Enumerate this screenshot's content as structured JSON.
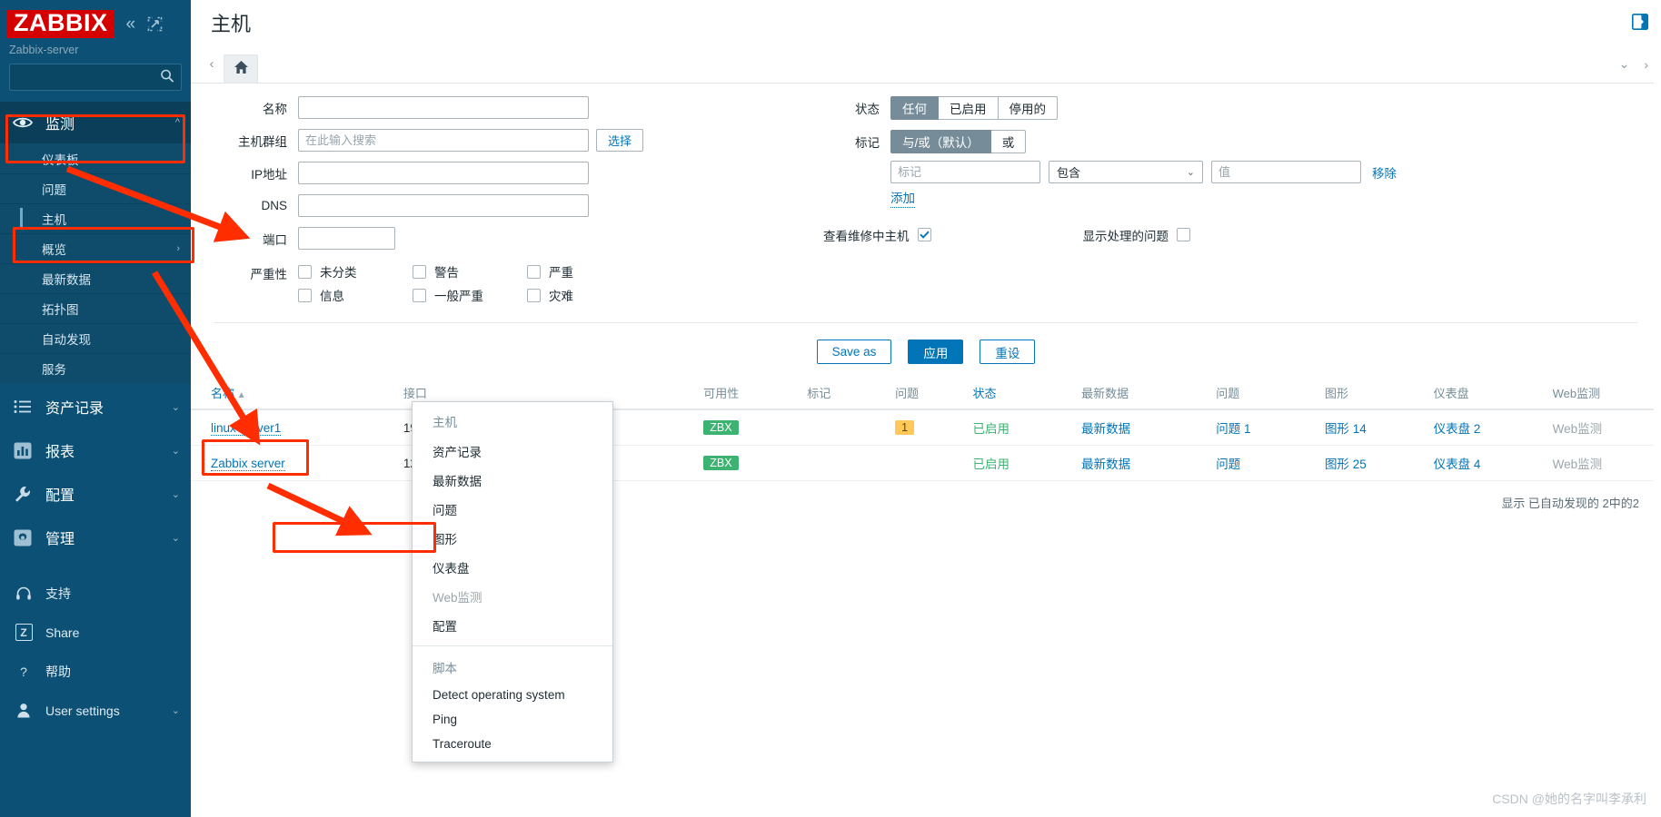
{
  "sidebar": {
    "logo": "ZABBIX",
    "collapse_icon": "chevron-double-left-icon",
    "expand_icon": "kiosk-expand-icon",
    "server_name": "Zabbix-server",
    "search_placeholder": "",
    "search_value": "",
    "monitoring": {
      "label": "监测",
      "icon": "eye-icon",
      "expanded": true,
      "items": [
        {
          "label": "仪表板",
          "selected": false,
          "has_chevron": false
        },
        {
          "label": "问题",
          "selected": false,
          "has_chevron": false
        },
        {
          "label": "主机",
          "selected": true,
          "has_chevron": false
        },
        {
          "label": "概览",
          "selected": false,
          "has_chevron": true
        },
        {
          "label": "最新数据",
          "selected": false,
          "has_chevron": false
        },
        {
          "label": "拓扑图",
          "selected": false,
          "has_chevron": false
        },
        {
          "label": "自动发现",
          "selected": false,
          "has_chevron": false
        },
        {
          "label": "服务",
          "selected": false,
          "has_chevron": false
        }
      ]
    },
    "sections": [
      {
        "label": "资产记录",
        "icon": "list-icon"
      },
      {
        "label": "报表",
        "icon": "bar-chart-icon"
      },
      {
        "label": "配置",
        "icon": "wrench-icon"
      },
      {
        "label": "管理",
        "icon": "gear-icon"
      }
    ],
    "footer": [
      {
        "label": "支持",
        "icon": "headset-icon",
        "chevron": false
      },
      {
        "label": "Share",
        "icon": "zabbix-share-icon",
        "chevron": false
      },
      {
        "label": "帮助",
        "icon": "question-icon",
        "chevron": false
      },
      {
        "label": "User settings",
        "icon": "user-icon",
        "chevron": true
      }
    ]
  },
  "header": {
    "title": "主机",
    "kiosk_icon": "kiosk-mode-icon"
  },
  "tabs": {
    "left_arrow_icon": "chevron-left-icon",
    "home_icon": "home-icon",
    "right_collapse_icon": "chevron-down-icon",
    "right_arrow_icon": "chevron-right-icon"
  },
  "filter": {
    "name": {
      "label": "名称",
      "value": "",
      "placeholder": ""
    },
    "host_group": {
      "label": "主机群组",
      "value": "",
      "placeholder": "在此输入搜索",
      "select_button": "选择"
    },
    "ip": {
      "label": "IP地址",
      "value": "",
      "placeholder": ""
    },
    "dns": {
      "label": "DNS",
      "value": "",
      "placeholder": ""
    },
    "port": {
      "label": "端口",
      "value": "",
      "placeholder": ""
    },
    "status": {
      "label": "状态",
      "options": [
        "任何",
        "已启用",
        "停用的"
      ],
      "selected": "任何"
    },
    "tags": {
      "label": "标记",
      "options": [
        "与/或（默认）",
        "或"
      ],
      "selected": "与/或（默认）",
      "tag_placeholder": "标记",
      "tag_value": "",
      "operator": "包含",
      "value_placeholder": "值",
      "value_value": "",
      "remove_label": "移除",
      "add_label": "添加"
    },
    "maintenance": {
      "label": "查看维修中主机",
      "checked": true
    },
    "show_suppressed": {
      "label": "显示处理的问题",
      "checked": false
    },
    "severity": {
      "label": "严重性",
      "items": [
        {
          "label": "未分类",
          "checked": false
        },
        {
          "label": "信息",
          "checked": false
        },
        {
          "label": "警告",
          "checked": false
        },
        {
          "label": "一般严重",
          "checked": false
        },
        {
          "label": "严重",
          "checked": false
        },
        {
          "label": "灾难",
          "checked": false
        }
      ]
    },
    "buttons": {
      "save_as": "Save as",
      "apply": "应用",
      "reset": "重设"
    }
  },
  "table": {
    "columns": [
      {
        "label": "名称",
        "sortable": true,
        "sort_icon": "▲"
      },
      {
        "label": "接口",
        "sortable": false
      },
      {
        "label": "可用性",
        "sortable": false
      },
      {
        "label": "标记",
        "sortable": false
      },
      {
        "label": "问题",
        "sortable": false
      },
      {
        "label": "状态",
        "sortable": true
      },
      {
        "label": "最新数据",
        "sortable": false
      },
      {
        "label": "问题",
        "sortable": false
      },
      {
        "label": "图形",
        "sortable": false
      },
      {
        "label": "仪表盘",
        "sortable": false
      },
      {
        "label": "Web监测",
        "sortable": false
      }
    ],
    "rows": [
      {
        "name": "linux-server1",
        "interface": "192.168.188.111:10050",
        "availability": "ZBX",
        "tags": "",
        "problems": "1",
        "status": "已启用",
        "latest_data": "最新数据",
        "problem_link": "问题 1",
        "graphs": "图形 14",
        "dashboards": "仪表盘 2",
        "web": "Web监测"
      },
      {
        "name": "Zabbix server",
        "interface": "127.0.0.1:10050",
        "availability": "ZBX",
        "tags": "",
        "problems": "",
        "status": "已启用",
        "latest_data": "最新数据",
        "problem_link": "问题",
        "graphs": "图形 25",
        "dashboards": "仪表盘 4",
        "web": "Web监测"
      }
    ],
    "footer_note": "显示 已自动发现的 2中的2"
  },
  "context_menu": {
    "group_host": {
      "title": "主机",
      "items": [
        {
          "label": "资产记录",
          "disabled": false,
          "highlighted": false
        },
        {
          "label": "最新数据",
          "disabled": false,
          "highlighted": true
        },
        {
          "label": "问题",
          "disabled": false,
          "highlighted": false
        },
        {
          "label": "图形",
          "disabled": false,
          "highlighted": false
        },
        {
          "label": "仪表盘",
          "disabled": false,
          "highlighted": false
        },
        {
          "label": "Web监测",
          "disabled": true,
          "highlighted": false
        },
        {
          "label": "配置",
          "disabled": false,
          "highlighted": false
        }
      ]
    },
    "group_scripts": {
      "title": "脚本",
      "items": [
        {
          "label": "Detect operating system",
          "disabled": false
        },
        {
          "label": "Ping",
          "disabled": false
        },
        {
          "label": "Traceroute",
          "disabled": false
        }
      ]
    }
  },
  "watermark": "CSDN @她的名字叫李承利",
  "colors": {
    "sidebar_bg": "#0c5175",
    "accent": "#0275b8",
    "logo_red": "#d40000",
    "zbx_green": "#3cb371",
    "problem_amber": "#ffc859",
    "annotation_red": "#ff2d00",
    "segment_active": "#768d99"
  }
}
